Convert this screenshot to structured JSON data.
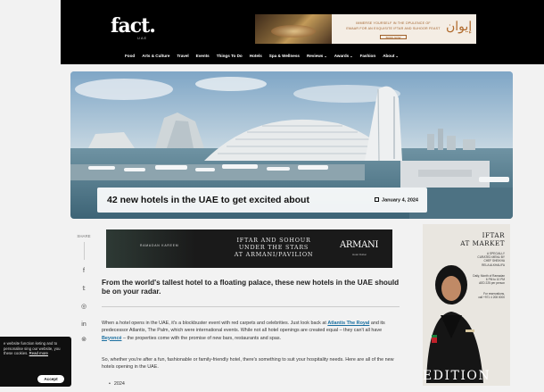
{
  "header": {
    "logo": "fact.",
    "logo_sub": "UAE",
    "banner": {
      "line1": "IMMERSE YOURSELF IN THE OPULENCE OF",
      "line2": "EMAAR FOR AN EXQUISITE IFTAR AND SUHOOR FEAST",
      "button": "BOOK NOW",
      "logo": "إيوان"
    }
  },
  "nav": {
    "items": [
      {
        "label": "Food",
        "dropdown": false
      },
      {
        "label": "Arts & Culture",
        "dropdown": false
      },
      {
        "label": "Travel",
        "dropdown": false
      },
      {
        "label": "Events",
        "dropdown": false
      },
      {
        "label": "Things To Do",
        "dropdown": false
      },
      {
        "label": "Hotels",
        "dropdown": false
      },
      {
        "label": "Spa & Wellness",
        "dropdown": false
      },
      {
        "label": "Reviews",
        "dropdown": true
      },
      {
        "label": "Awards",
        "dropdown": true
      },
      {
        "label": "Fashion",
        "dropdown": false
      },
      {
        "label": "About",
        "dropdown": true
      }
    ],
    "chevron": "⌄"
  },
  "hero": {
    "title": "42 new hotels in the UAE to get excited about",
    "date": "January 4, 2024"
  },
  "share": {
    "label": "SHARE",
    "icons": [
      "facebook-icon",
      "twitter-icon",
      "whatsapp-icon",
      "linkedin-icon",
      "pinterest-icon"
    ],
    "glyphs": [
      "f",
      "𝕥",
      "◎",
      "in",
      "⊚"
    ]
  },
  "mid_ad": {
    "left_text": "RAMADAN KAREEM",
    "center_line1": "IFTAR AND SOHOUR",
    "center_line2": "UNDER THE STARS",
    "center_line3": "AT ARMANI/PAVILION",
    "brand": "ARMANI",
    "brand_sub": "Hotel Dubai"
  },
  "article": {
    "lede": "From the world's tallest hotel to a floating palace, these new hotels in the UAE should be on your radar.",
    "p1_a": "When a hotel opens in the UAE, it's a blockbuster event with red carpets and celebrities. Just look back at ",
    "p1_link1": "Atlantis The Royal",
    "p1_b": " and its predecessor Atlantis, The Palm, which were international events. While not all hotel openings are created equal – they can't all have ",
    "p1_link2": "Beyoncé",
    "p1_c": " – the properties come with the promise of new bars, restaurants and spas.",
    "p2": "So, whether you're after a fun, fashionable or family-friendly hotel, there's something to suit your hospitality needs. Here are all of the new hotels opening in the UAE.",
    "bullet": "2024"
  },
  "side_ad": {
    "title1": "IFTAR",
    "title2": "AT MARKET",
    "sub1": "A SPECIALLY",
    "sub2": "CURATED MENU BY",
    "sub3": "CHEF SHEIKHA",
    "sub4": "RELA ALKHALIFA",
    "info1": "Daily, Month of Ramadan",
    "info2": "6 PM to 10 PM",
    "info3": "AED 225 per person",
    "info4": "For reservations,",
    "info5": "call +971 4 208 0000",
    "edition": "EDITION"
  },
  "cookie": {
    "text": "e website function keting and to personalise sing our website, you these cookies.",
    "link": "Read more",
    "button": "Accept"
  },
  "colors": {
    "header_bg": "#000000",
    "link": "#1a6fa0",
    "accent_ad": "#a0602a"
  }
}
